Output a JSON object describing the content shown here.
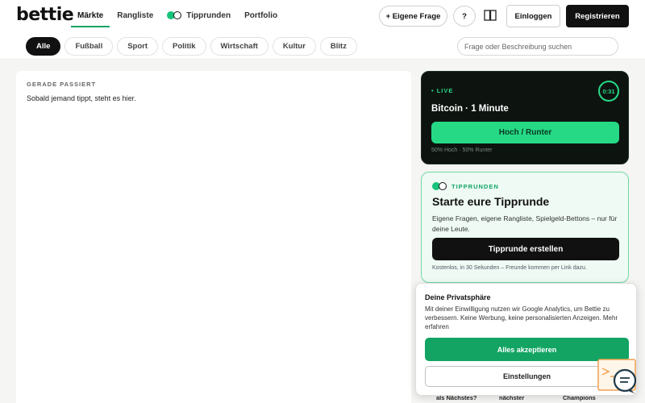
{
  "header": {
    "logo": "bettie",
    "nav": [
      {
        "label": "Märkte",
        "active": true
      },
      {
        "label": "Rangliste",
        "active": false
      },
      {
        "label": "Tipprunden",
        "active": false,
        "icon": "toggle-icon"
      },
      {
        "label": "Portfolio",
        "active": false
      }
    ],
    "own_question": "+ Eigene Frage",
    "help": "?",
    "login": "Einloggen",
    "register": "Registrieren"
  },
  "filters": {
    "chips": [
      {
        "label": "Alle",
        "active": true
      },
      {
        "label": "Fußball",
        "active": false
      },
      {
        "label": "Sport",
        "active": false
      },
      {
        "label": "Politik",
        "active": false
      },
      {
        "label": "Wirtschaft",
        "active": false
      },
      {
        "label": "Kultur",
        "active": false
      },
      {
        "label": "Blitz",
        "active": false
      }
    ],
    "search_placeholder": "Frage oder Beschreibung suchen"
  },
  "feed": {
    "title": "GERADE PASSIERT",
    "empty_text": "Sobald jemand tippt, steht es hier."
  },
  "live": {
    "badge": "• LIVE",
    "timer": "0:31",
    "title": "Bitcoin · 1 Minute",
    "button": "Hoch / Runter",
    "split": "50% Hoch · 50% Runter"
  },
  "tipprunden": {
    "badge": "TIPPRUNDEN",
    "title": "Starte eure Tipprunde",
    "description": "Eigene Fragen, eigene Rangliste, Spielgeld-Bettons – nur für deine Leute.",
    "button": "Tipprunde erstellen",
    "note": "Kostenlos, in 30 Sekunden – Freunde kommen per Link dazu."
  },
  "peek": [
    "als Nächstes?",
    "nächster",
    "Champions"
  ],
  "cookie": {
    "title": "Deine Privatsphäre",
    "text": "Mit deiner Einwilligung nutzen wir Google Analytics, um Bettie zu verbessern. Keine Werbung, keine personalisierten Anzeigen. Mehr erfahren",
    "accept": "Alles akzeptieren",
    "settings": "Einstellungen"
  },
  "colors": {
    "accent": "#11a566",
    "live_green": "#26d985",
    "dark": "#111111"
  }
}
